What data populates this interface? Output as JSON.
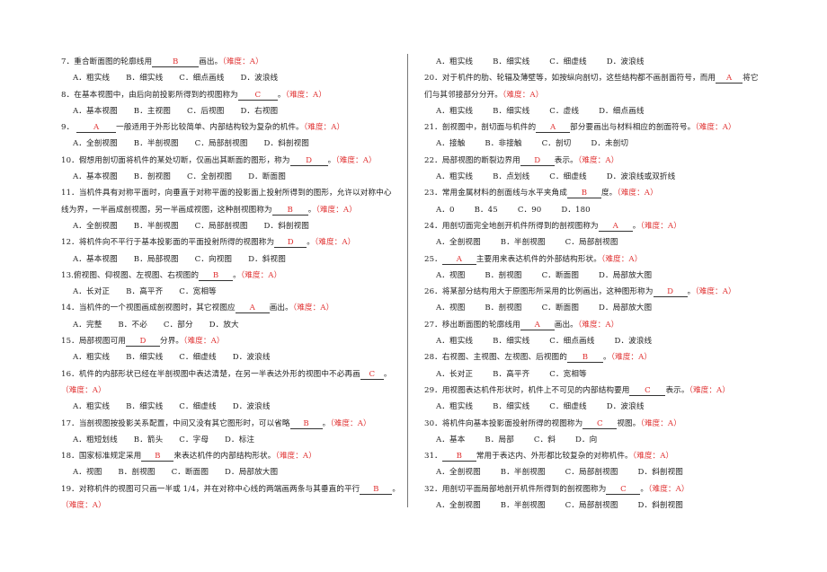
{
  "difficulty_label": "（难度：A）",
  "left_column": [
    {
      "type": "q",
      "pre": "7．重合断面图的轮廓线用",
      "answer": "B",
      "post": "画出。",
      "blank_w": 52
    },
    {
      "type": "opts",
      "items": [
        "A．粗实线",
        "B．细实线",
        "C．细点画线",
        "D．波浪线"
      ]
    },
    {
      "type": "q",
      "pre": "8．在基本视图中，由后向前投影所得到的视图称为",
      "answer": "C",
      "post": "。",
      "blank_w": 44
    },
    {
      "type": "opts",
      "items": [
        "A．基本视图",
        "B．主视图",
        "C．后视图",
        "D．右视图"
      ]
    },
    {
      "type": "q",
      "pre": "9．  ",
      "answer": "A",
      "post": "一般适用于外形比较简单、内部结构较为复杂的机件。",
      "blank_w": 44
    },
    {
      "type": "opts",
      "items": [
        "A．全剖视图",
        "B．半剖视图",
        "C．局部剖视图",
        "D．斜剖视图"
      ]
    },
    {
      "type": "q",
      "pre": "10．假想用剖切面将机件的某处切断，仅画出其断面的图形，称为",
      "answer": "D",
      "post": "。",
      "blank_w": 42
    },
    {
      "type": "opts",
      "items": [
        "A．基本视图",
        "B．剖视图",
        "C．全剖视图",
        "D．断面图"
      ]
    },
    {
      "type": "text",
      "text": "11．当机件具有对称平面时，向垂直于对称平面的投影面上投射所得到的图形，允许以对称中心"
    },
    {
      "type": "q",
      "pre": "线为界，一半画成剖视图，另一半画成视图，这种剖视图称为",
      "answer": "B",
      "post": "。",
      "blank_w": 40
    },
    {
      "type": "opts",
      "items": [
        "A．全剖视图",
        "B．半剖视图",
        "C．局部剖视图",
        "D．斜剖视图"
      ]
    },
    {
      "type": "q",
      "pre": "12．将机件向不平行于基本投影面的平面投射所得的视图称为",
      "answer": "D",
      "post": "。",
      "blank_w": 36
    },
    {
      "type": "opts",
      "items": [
        "A．基本视图",
        "B．局部视图",
        "C．向视图",
        "D．斜视图"
      ]
    },
    {
      "type": "q",
      "pre": "13.俯视图、仰视图、左视图、右视图的",
      "answer": "B",
      "post": "。",
      "blank_w": 38
    },
    {
      "type": "opts",
      "items": [
        "A．长对正",
        "B．高平齐",
        "C．宽相等"
      ]
    },
    {
      "type": "q",
      "pre": "14．当机件的一个视图画成剖视图时，其它视图应",
      "answer": "A",
      "post": "画出。",
      "blank_w": 38
    },
    {
      "type": "opts",
      "items": [
        "A．完整",
        "B．不必",
        "C．部分",
        "D．放大"
      ]
    },
    {
      "type": "q",
      "pre": "15．局部视图可用",
      "answer": "D",
      "post": "分界。",
      "blank_w": 38
    },
    {
      "type": "opts",
      "items": [
        "A．粗实线",
        "B．细实线",
        "C．细虚线",
        "D．波浪线"
      ]
    },
    {
      "type": "q",
      "pre": "16．机件的内部形状已经在半剖视图中表达清楚，在另一半表达外形的视图中不必再画",
      "answer": "C",
      "post": "。",
      "blank_w": 26,
      "no_diff": true
    },
    {
      "type": "diff_only"
    },
    {
      "type": "opts",
      "items": [
        "A．粗实线",
        "B．细实线",
        "C．细虚线",
        "D．波浪线"
      ]
    },
    {
      "type": "q",
      "pre": "17．当剖视图按投影关系配置，中间又没有其它图形时，可以省略",
      "answer": "B",
      "post": "。",
      "blank_w": 36
    },
    {
      "type": "opts",
      "items": [
        "A．粗短划线",
        "B．箭头",
        "C．字母",
        "D．标注"
      ]
    },
    {
      "type": "q",
      "pre": "18．国家标准规定采用",
      "answer": "B",
      "post": "来表达机件的内部结构形状。",
      "blank_w": 36
    },
    {
      "type": "opts",
      "items": [
        "A．视图",
        "B．剖视图",
        "C．断面图",
        "D．局部放大图"
      ]
    },
    {
      "type": "q",
      "pre": "19．对称机件的视图可只画一半或 1/4，并在对称中心线的两端画两条与其垂直的平行",
      "answer": "B",
      "post": "。",
      "blank_w": 36,
      "no_diff": true
    },
    {
      "type": "diff_only"
    }
  ],
  "right_column": [
    {
      "type": "opts",
      "items": [
        "A．粗实线",
        "B．细实线",
        "C．细虚线",
        "D．波浪线"
      ]
    },
    {
      "type": "q",
      "pre": "20．对于机件的肋、轮辐及薄壁等，如按纵向剖切，这些结构都不画剖面符号，而用",
      "answer": "A",
      "post": "将它",
      "blank_w": 30,
      "no_diff": true
    },
    {
      "type": "text_diff",
      "text": "们与其邻接部分分开。"
    },
    {
      "type": "opts",
      "items": [
        "A．粗实线",
        "B．细实线",
        "C．虚线",
        "D．细点画线"
      ]
    },
    {
      "type": "q",
      "pre": "21．剖视图中，剖切面与机件的",
      "answer": "A",
      "post": "部分要画出与材料相应的剖面符号。",
      "blank_w": 38
    },
    {
      "type": "opts",
      "items": [
        "A．接触",
        "B．非接触",
        "C．剖切",
        "D．未剖切"
      ]
    },
    {
      "type": "q",
      "pre": "22．局部视图的断裂边界用",
      "answer": "D",
      "post": "表示。",
      "blank_w": 38
    },
    {
      "type": "opts",
      "items": [
        "A．粗实线",
        "B．点划线",
        "C．细虚线",
        "D．波浪线或双折线"
      ]
    },
    {
      "type": "q",
      "pre": "23．常用金属材料的剖面线与水平夹角成",
      "answer": "B",
      "post": "度。",
      "blank_w": 38
    },
    {
      "type": "opts",
      "items": [
        "A．0",
        "B．45",
        "C．90",
        "D．180"
      ]
    },
    {
      "type": "q",
      "pre": "24．用剖切面完全地剖开机件所得到的剖视图称为",
      "answer": "A",
      "post": "。",
      "blank_w": 38
    },
    {
      "type": "opts",
      "items": [
        "A．全剖视图",
        "B．半剖视图",
        "C．局部剖视图"
      ]
    },
    {
      "type": "q",
      "pre": "25．",
      "answer": "A",
      "post": "主要用来表达机件的外部结构形状。",
      "blank_w": 38
    },
    {
      "type": "opts",
      "items": [
        "A．视图",
        "B．剖视图",
        "C．断面图",
        "D．局部放大图"
      ]
    },
    {
      "type": "q",
      "pre": "26．将某部分结构用大于原图形所采用的比例画出，这种图形称为",
      "answer": "D",
      "post": "。",
      "blank_w": 38
    },
    {
      "type": "opts",
      "items": [
        "A．视图",
        "B．剖视图",
        "C．断面图",
        "D．局部放大图"
      ]
    },
    {
      "type": "q",
      "pre": "27．移出断面图的轮廓线用",
      "answer": "A",
      "post": "画出。",
      "blank_w": 38
    },
    {
      "type": "opts",
      "items": [
        "A．粗实线",
        "B．细实线",
        "C．细点画线",
        "D．波浪线"
      ]
    },
    {
      "type": "q",
      "pre": "28．右视图、主视图、左视图、后视图的",
      "answer": "B",
      "post": "。",
      "blank_w": 40
    },
    {
      "type": "opts",
      "items": [
        "A．长对正",
        "B．高平齐",
        "C．宽相等"
      ]
    },
    {
      "type": "q",
      "pre": "29．用视图表达机件形状时，机件上不可见的内部结构要用",
      "answer": "C",
      "post": "表示。",
      "blank_w": 40
    },
    {
      "type": "opts",
      "items": [
        "A．粗实线",
        "B．细实线",
        "C．细虚线",
        "D．波浪线"
      ]
    },
    {
      "type": "q",
      "pre": "30．将机件向基本投影面投射所得的视图称为",
      "answer": "C",
      "post": "视图。",
      "blank_w": 38
    },
    {
      "type": "opts",
      "items": [
        "A．基本",
        "B．局部",
        "C．斜",
        "D．向"
      ]
    },
    {
      "type": "q",
      "pre": "31．",
      "answer": "B",
      "post": "常用于表达内、外形都比较复杂的对称机件。",
      "blank_w": 38
    },
    {
      "type": "opts",
      "items": [
        "A．全剖视图",
        "B．半剖视图",
        "C．局部剖视图",
        "D．斜剖视图"
      ]
    },
    {
      "type": "q",
      "pre": "32．用剖切平面局部地剖开机件所得到的剖视图称为",
      "answer": "C",
      "post": "。",
      "blank_w": 38
    },
    {
      "type": "opts",
      "items": [
        "A．全剖视图",
        "B．半剖视图",
        "C．局部剖视图",
        "D．斜剖视图"
      ]
    }
  ]
}
